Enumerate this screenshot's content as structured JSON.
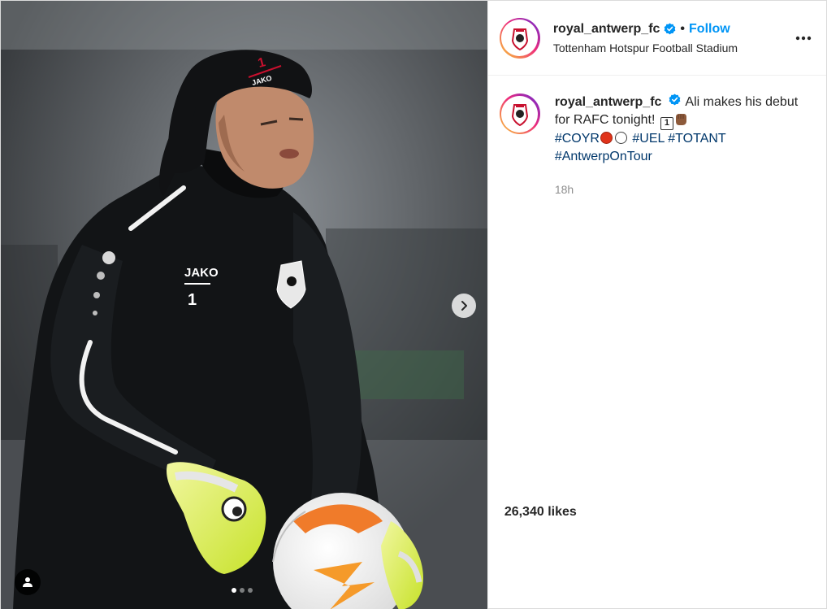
{
  "post": {
    "username": "royal_antwerp_fc",
    "follow_label": "Follow",
    "separator": "•",
    "location": "Tottenham Hotspur Football Stadium",
    "caption": {
      "text_part1": "Ali makes his debut for RAFC tonight!",
      "emoji_number": "1",
      "hashtag_coyr": "#COYR",
      "hashtag_uel": "#UEL",
      "hashtag_totant": "#TOTANT",
      "hashtag_tour": "#AntwerpOnTour"
    },
    "time": "18h",
    "likes": "26,340 likes"
  },
  "photo": {
    "jacket_brand": "JAKO",
    "jacket_number": "1",
    "hat_brand": "JAKO",
    "hat_number": "1"
  },
  "carousel": {
    "total": 3,
    "active": 0
  },
  "colors": {
    "follow": "#0095f6",
    "hashtag": "#00376b",
    "club_red": "#c8102e",
    "verified": "#0095f6"
  },
  "icons": {
    "verified": "verified-badge-icon",
    "more": "more-options-icon",
    "next": "chevron-right-icon",
    "tag": "user-tag-icon"
  }
}
